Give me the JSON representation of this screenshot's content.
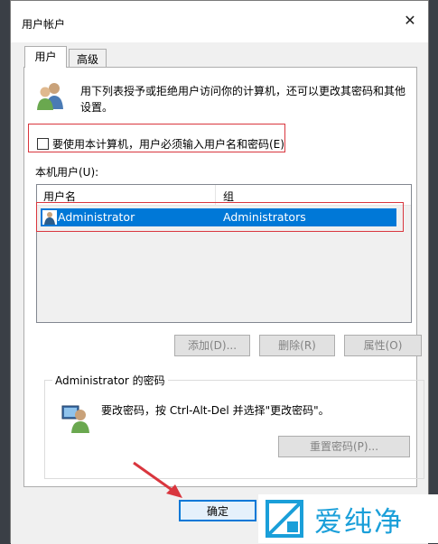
{
  "window": {
    "title": "用户帐户",
    "close_symbol": "✕"
  },
  "tabs": [
    {
      "label": "用户",
      "active": true
    },
    {
      "label": "高级",
      "active": false
    }
  ],
  "users_tab": {
    "description": "用下列表授予或拒绝用户访问你的计算机，还可以更改其密码和其他设置。",
    "require_password_checkbox": {
      "label": "要使用本计算机，用户必须输入用户名和密码(E)",
      "checked": false
    },
    "local_users_label": "本机用户(U):",
    "table": {
      "columns": [
        "用户名",
        "组"
      ],
      "rows": [
        {
          "username": "Administrator",
          "group": "Administrators",
          "selected": true
        }
      ]
    },
    "buttons": {
      "add": "添加(D)...",
      "remove": "删除(R)",
      "properties": "属性(O)"
    },
    "password_group": {
      "title": "Administrator 的密码",
      "instruction": "要改密码，按 Ctrl-Alt-Del 并选择\"更改密码\"。",
      "reset_button": "重置密码(P)..."
    }
  },
  "footer": {
    "ok_button": "确定"
  },
  "watermark": {
    "brand": "爱纯净"
  },
  "colors": {
    "selection": "#0078d7",
    "highlight_box": "#d9363e",
    "arrow": "#d9363e",
    "brand": "#1a9fd9"
  }
}
